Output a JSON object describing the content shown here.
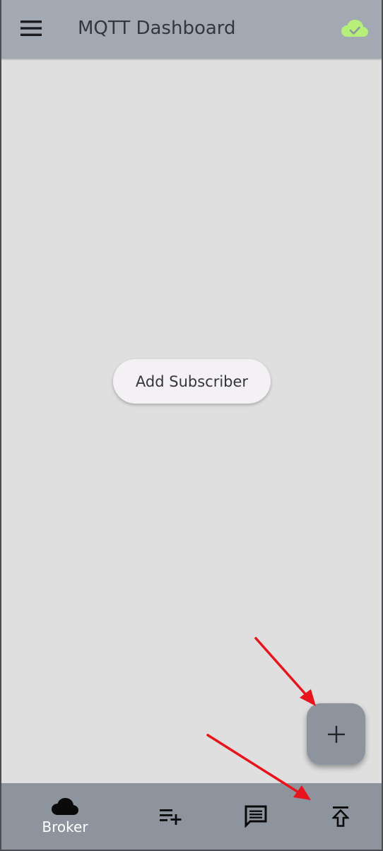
{
  "app_bar": {
    "title": "MQTT Dashboard",
    "menu_icon": "menu-icon",
    "status_icon": "cloud-done-icon",
    "status_color": "#b6f07a"
  },
  "main": {
    "add_subscriber_label": "Add Subscriber"
  },
  "fab": {
    "icon": "plus-icon"
  },
  "bottom_nav": {
    "items": [
      {
        "label": "Broker",
        "icon": "cloud-icon",
        "selected": true
      },
      {
        "label": "",
        "icon": "playlist-add-icon"
      },
      {
        "label": "",
        "icon": "message-icon"
      },
      {
        "label": "",
        "icon": "publish-icon"
      }
    ]
  },
  "annotations": {
    "arrow_color": "#e8141c"
  }
}
